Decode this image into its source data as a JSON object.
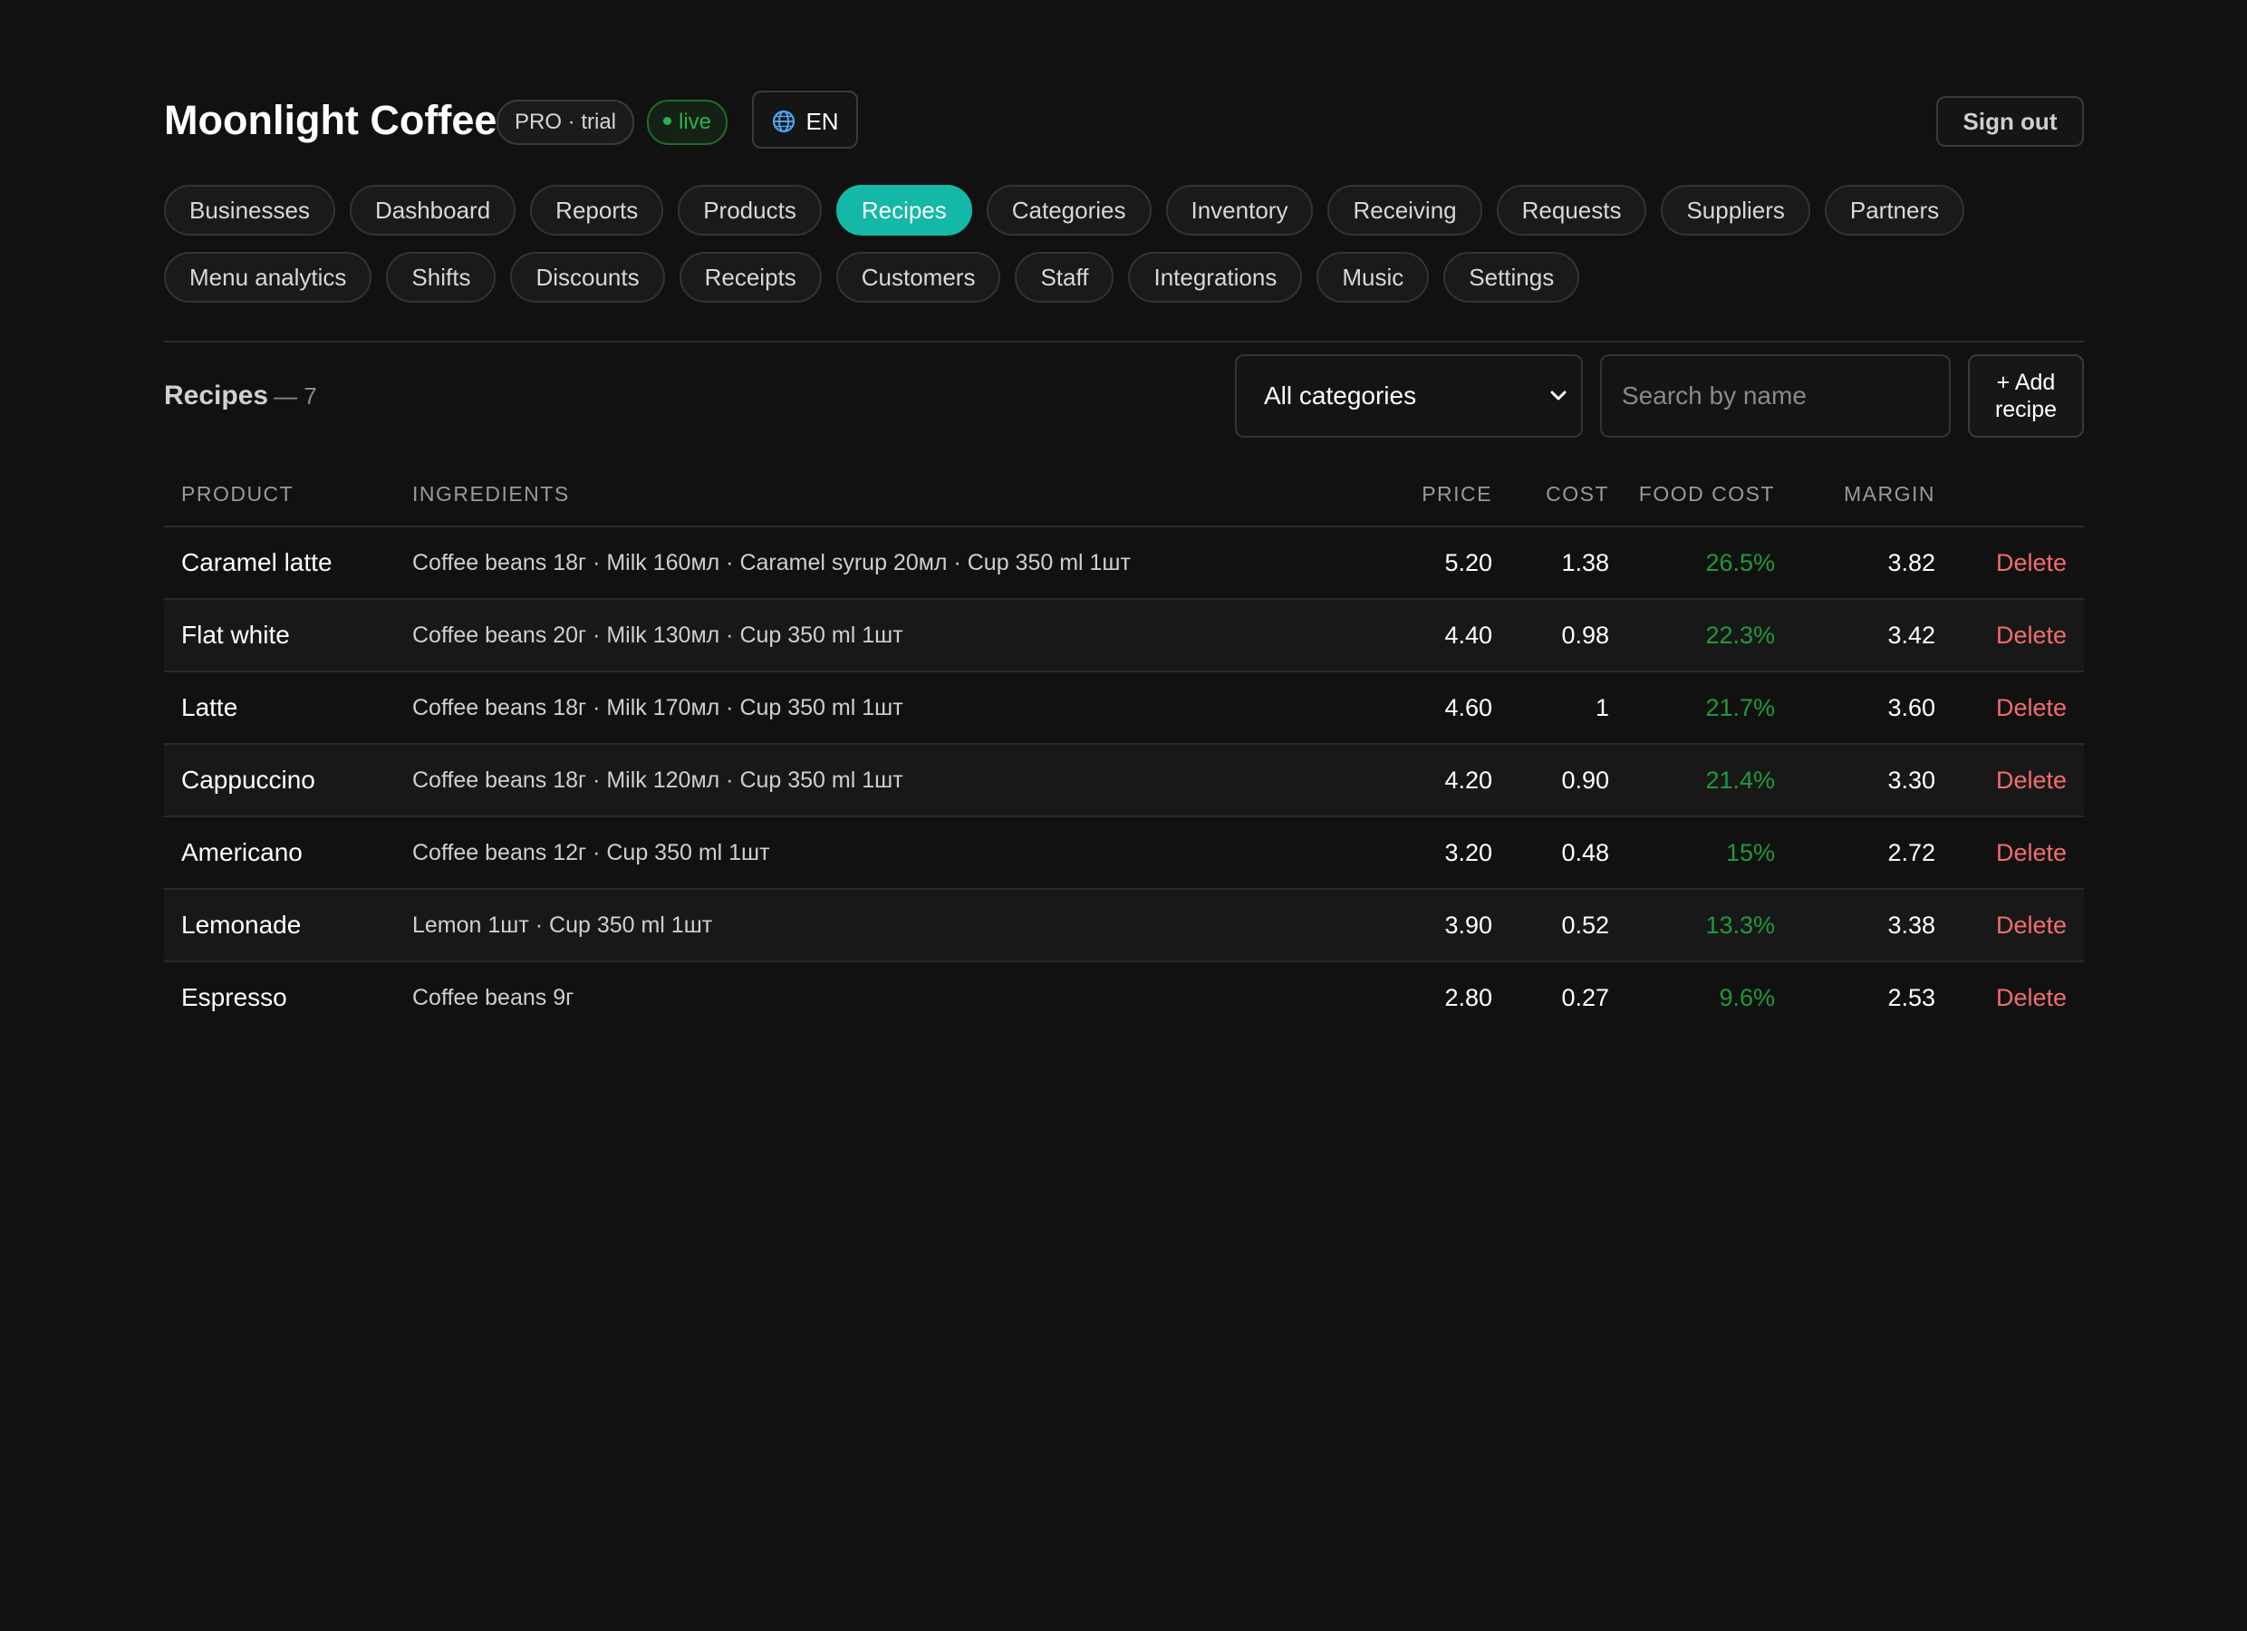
{
  "header": {
    "brand": "Moonlight Coffee",
    "plan_badge": "PRO · trial",
    "status_badge": "live",
    "language": "EN",
    "sign_out": "Sign out"
  },
  "nav": {
    "active": "Recipes",
    "row1": [
      "Businesses",
      "Dashboard",
      "Reports",
      "Products",
      "Recipes",
      "Categories",
      "Inventory",
      "Receiving",
      "Requests",
      "Suppliers",
      "Partners"
    ],
    "row2": [
      "Menu analytics",
      "Shifts",
      "Discounts",
      "Receipts",
      "Customers",
      "Staff",
      "Integrations",
      "Music",
      "Settings"
    ]
  },
  "toolbar": {
    "title": "Recipes",
    "count": "— 7",
    "category_selected": "All categories",
    "search_placeholder": "Search by name",
    "add_line1": "+ Add",
    "add_line2": "recipe"
  },
  "table": {
    "columns": {
      "product": "PRODUCT",
      "ingredients": "INGREDIENTS",
      "price": "PRICE",
      "cost": "COST",
      "food_cost": "FOOD COST",
      "margin": "MARGIN"
    },
    "delete_label": "Delete",
    "rows": [
      {
        "product": "Caramel latte",
        "ingredients": "Coffee beans 18г · Milk 160мл · Caramel syrup 20мл · Cup 350 ml 1шт",
        "price": "5.20",
        "cost": "1.38",
        "food_cost": "26.5%",
        "margin": "3.82"
      },
      {
        "product": "Flat white",
        "ingredients": "Coffee beans 20г · Milk 130мл · Cup 350 ml 1шт",
        "price": "4.40",
        "cost": "0.98",
        "food_cost": "22.3%",
        "margin": "3.42"
      },
      {
        "product": "Latte",
        "ingredients": "Coffee beans 18г · Milk 170мл · Cup 350 ml 1шт",
        "price": "4.60",
        "cost": "1",
        "food_cost": "21.7%",
        "margin": "3.60"
      },
      {
        "product": "Cappuccino",
        "ingredients": "Coffee beans 18г · Milk 120мл · Cup 350 ml 1шт",
        "price": "4.20",
        "cost": "0.90",
        "food_cost": "21.4%",
        "margin": "3.30"
      },
      {
        "product": "Americano",
        "ingredients": "Coffee beans 12г · Cup 350 ml 1шт",
        "price": "3.20",
        "cost": "0.48",
        "food_cost": "15%",
        "margin": "2.72"
      },
      {
        "product": "Lemonade",
        "ingredients": "Lemon 1шт · Cup 350 ml 1шт",
        "price": "3.90",
        "cost": "0.52",
        "food_cost": "13.3%",
        "margin": "3.38"
      },
      {
        "product": "Espresso",
        "ingredients": "Coffee beans 9г",
        "price": "2.80",
        "cost": "0.27",
        "food_cost": "9.6%",
        "margin": "2.53"
      }
    ]
  },
  "colors": {
    "accent": "#14b8a6",
    "background": "#111111",
    "food_cost": "#1f9a3a",
    "delete": "#f26d6d",
    "live": "#2bb24a"
  },
  "icons": {
    "language": "globe-icon",
    "select": "chevron-down-icon"
  }
}
